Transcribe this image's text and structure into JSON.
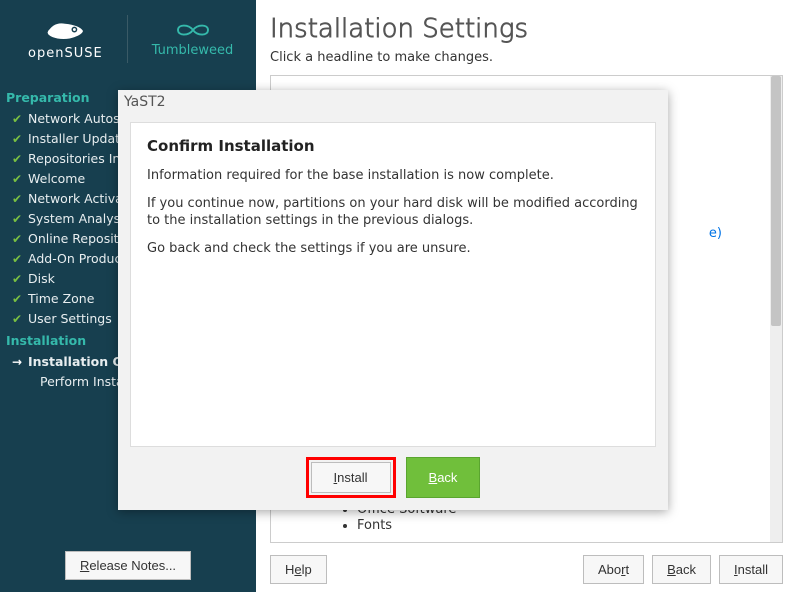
{
  "brand": {
    "name": "openSUSE",
    "variant": "Tumbleweed"
  },
  "nav": {
    "section1": "Preparation",
    "items1": [
      {
        "label": "Network Autosetup",
        "done": true
      },
      {
        "label": "Installer Update",
        "done": true
      },
      {
        "label": "Repositories Initialization",
        "done": true
      },
      {
        "label": "Welcome",
        "done": true
      },
      {
        "label": "Network Activation",
        "done": true
      },
      {
        "label": "System Analysis",
        "done": true
      },
      {
        "label": "Online Repositories",
        "done": true
      },
      {
        "label": "Add-On Products",
        "done": true
      },
      {
        "label": "Disk",
        "done": true
      },
      {
        "label": "Time Zone",
        "done": true
      },
      {
        "label": "User Settings",
        "done": true
      }
    ],
    "section2": "Installation",
    "items2": [
      {
        "label": "Installation Overview",
        "current": true
      },
      {
        "label": "Perform Installation",
        "current": false
      }
    ]
  },
  "sidebar_footer": {
    "release_notes": "Release Notes..."
  },
  "main": {
    "title": "Installation Settings",
    "subtitle": "Click a headline to make changes.",
    "link_text": "(some link here)",
    "software_items": [
      "Office Software",
      "Fonts"
    ]
  },
  "bottom": {
    "help": "Help",
    "abort": "Abort",
    "back": "Back",
    "install": "Install"
  },
  "modal": {
    "window_title": "YaST2",
    "heading": "Confirm Installation",
    "p1": "Information required for the base installation is now complete.",
    "p2": "If you continue now, partitions on your hard disk will be modified according to the installation settings in the previous dialogs.",
    "p3": "Go back and check the settings if you are unsure.",
    "install": "Install",
    "back": "Back"
  }
}
